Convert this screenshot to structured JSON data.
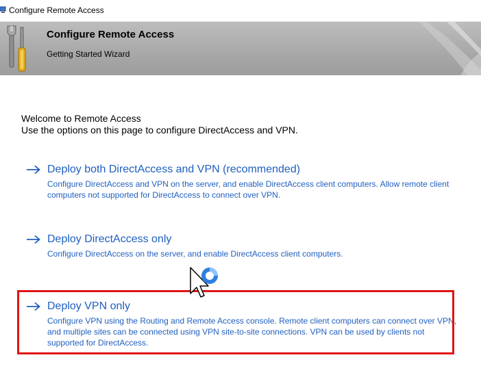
{
  "window": {
    "title": "Configure Remote Access"
  },
  "banner": {
    "title": "Configure Remote Access",
    "subtitle": "Getting Started Wizard"
  },
  "intro": {
    "line1": "Welcome to Remote Access",
    "line2": "Use the options on this page to configure DirectAccess and VPN."
  },
  "options": [
    {
      "title": "Deploy both DirectAccess and VPN (recommended)",
      "description": "Configure DirectAccess and VPN on the server, and enable DirectAccess client computers. Allow remote client computers not supported for DirectAccess to connect over VPN."
    },
    {
      "title": "Deploy DirectAccess only",
      "description": "Configure DirectAccess on the server, and enable DirectAccess client computers."
    },
    {
      "title": "Deploy VPN only",
      "description": "Configure VPN using the Routing and Remote Access console. Remote client computers can connect over VPN, and multiple sites can be connected using VPN site-to-site connections. VPN can be used by clients not supported for DirectAccess."
    }
  ],
  "icons": {
    "window_icon": "remote-access-icon",
    "banner_icon": "tools-icon",
    "option_icon": "arrow-right-icon",
    "cursor": "busy-cursor-icon"
  },
  "colors": {
    "link": "#1f5fbf",
    "highlight": "#e01414",
    "banner": "#a9a9a9"
  }
}
